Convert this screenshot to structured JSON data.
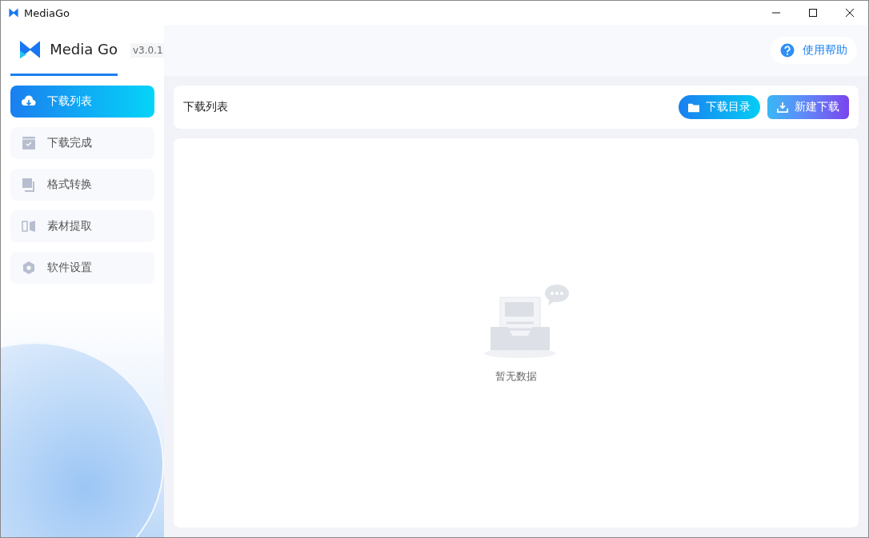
{
  "window": {
    "title": "MediaGo"
  },
  "header": {
    "app_name": "Media Go",
    "version": "v3.0.1",
    "help": "使用帮助"
  },
  "sidebar": {
    "items": [
      {
        "kind": "download",
        "label": "下载列表",
        "selected": true
      },
      {
        "kind": "done",
        "label": "下载完成",
        "selected": false
      },
      {
        "kind": "convert",
        "label": "格式转换",
        "selected": false
      },
      {
        "kind": "extract",
        "label": "素材提取",
        "selected": false
      },
      {
        "kind": "settings",
        "label": "软件设置",
        "selected": false
      }
    ]
  },
  "toolbar": {
    "title": "下载列表",
    "buttons": [
      {
        "kind": "folder",
        "label": "下载目录"
      },
      {
        "kind": "new",
        "label": "新建下载"
      }
    ]
  },
  "empty": {
    "text": "暂无数据"
  }
}
